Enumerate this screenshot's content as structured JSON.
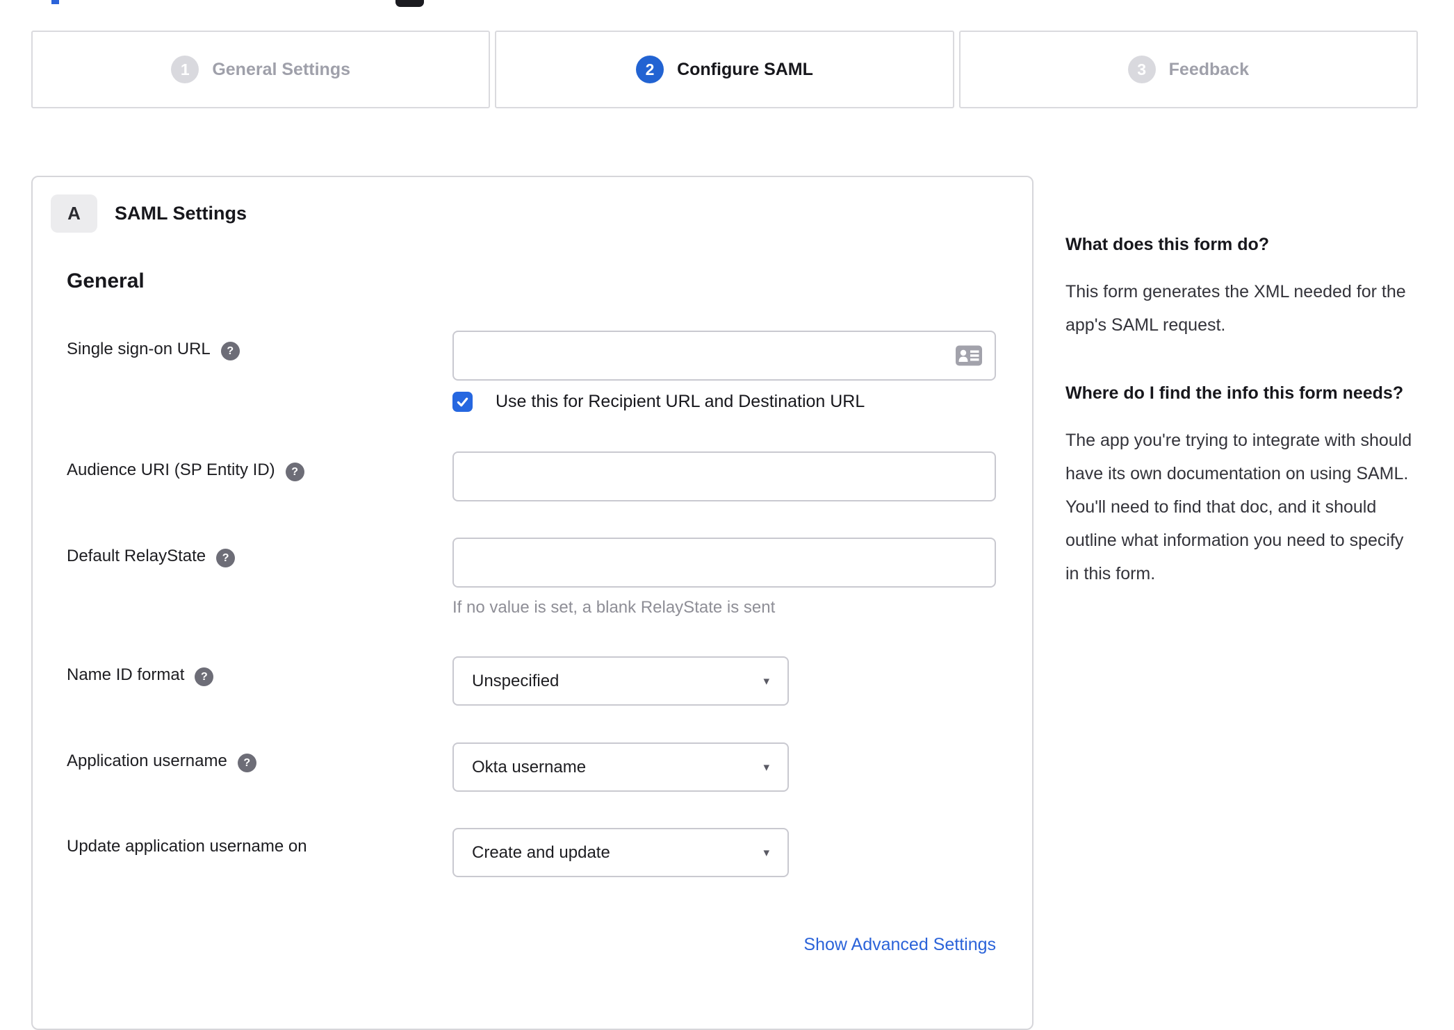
{
  "header": {
    "fragments": [
      "clipped-blue-fragment",
      "clipped-dark-fragment"
    ]
  },
  "stepper": {
    "steps": [
      {
        "number": "1",
        "label": "General Settings",
        "state": "inactive"
      },
      {
        "number": "2",
        "label": "Configure SAML",
        "state": "active"
      },
      {
        "number": "3",
        "label": "Feedback",
        "state": "inactive"
      }
    ]
  },
  "panel": {
    "section_badge": "A",
    "title": "SAML Settings",
    "group_heading": "General",
    "fields": {
      "sso_url": {
        "label": "Single sign-on URL",
        "value": "",
        "has_help": true
      },
      "sso_checkbox": {
        "label": "Use this for Recipient URL and Destination URL",
        "checked": true
      },
      "audience_uri": {
        "label": "Audience URI (SP Entity ID)",
        "value": "",
        "has_help": true
      },
      "relay_state": {
        "label": "Default RelayState",
        "value": "",
        "has_help": true,
        "hint": "If no value is set, a blank RelayState is sent"
      },
      "name_id_format": {
        "label": "Name ID format",
        "value": "Unspecified",
        "has_help": true
      },
      "app_username": {
        "label": "Application username",
        "value": "Okta username",
        "has_help": true
      },
      "update_username": {
        "label": "Update application username on",
        "value": "Create and update",
        "has_help": false
      }
    },
    "advanced_link": "Show Advanced Settings"
  },
  "sidebar": {
    "sections": [
      {
        "heading": "What does this form do?",
        "body": "This form generates the XML needed for the app's SAML request."
      },
      {
        "heading": "Where do I find the info this form needs?",
        "body": "The app you're trying to integrate with should have its own documentation on using SAML. You'll need to find that doc, and it should outline what information you need to specify in this form."
      }
    ]
  },
  "icons": {
    "help_glyph": "?",
    "caret_glyph": "▾"
  },
  "colors": {
    "accent_blue": "#2263d2",
    "checkbox_blue": "#2667e0",
    "link_blue": "#2b63d9"
  }
}
